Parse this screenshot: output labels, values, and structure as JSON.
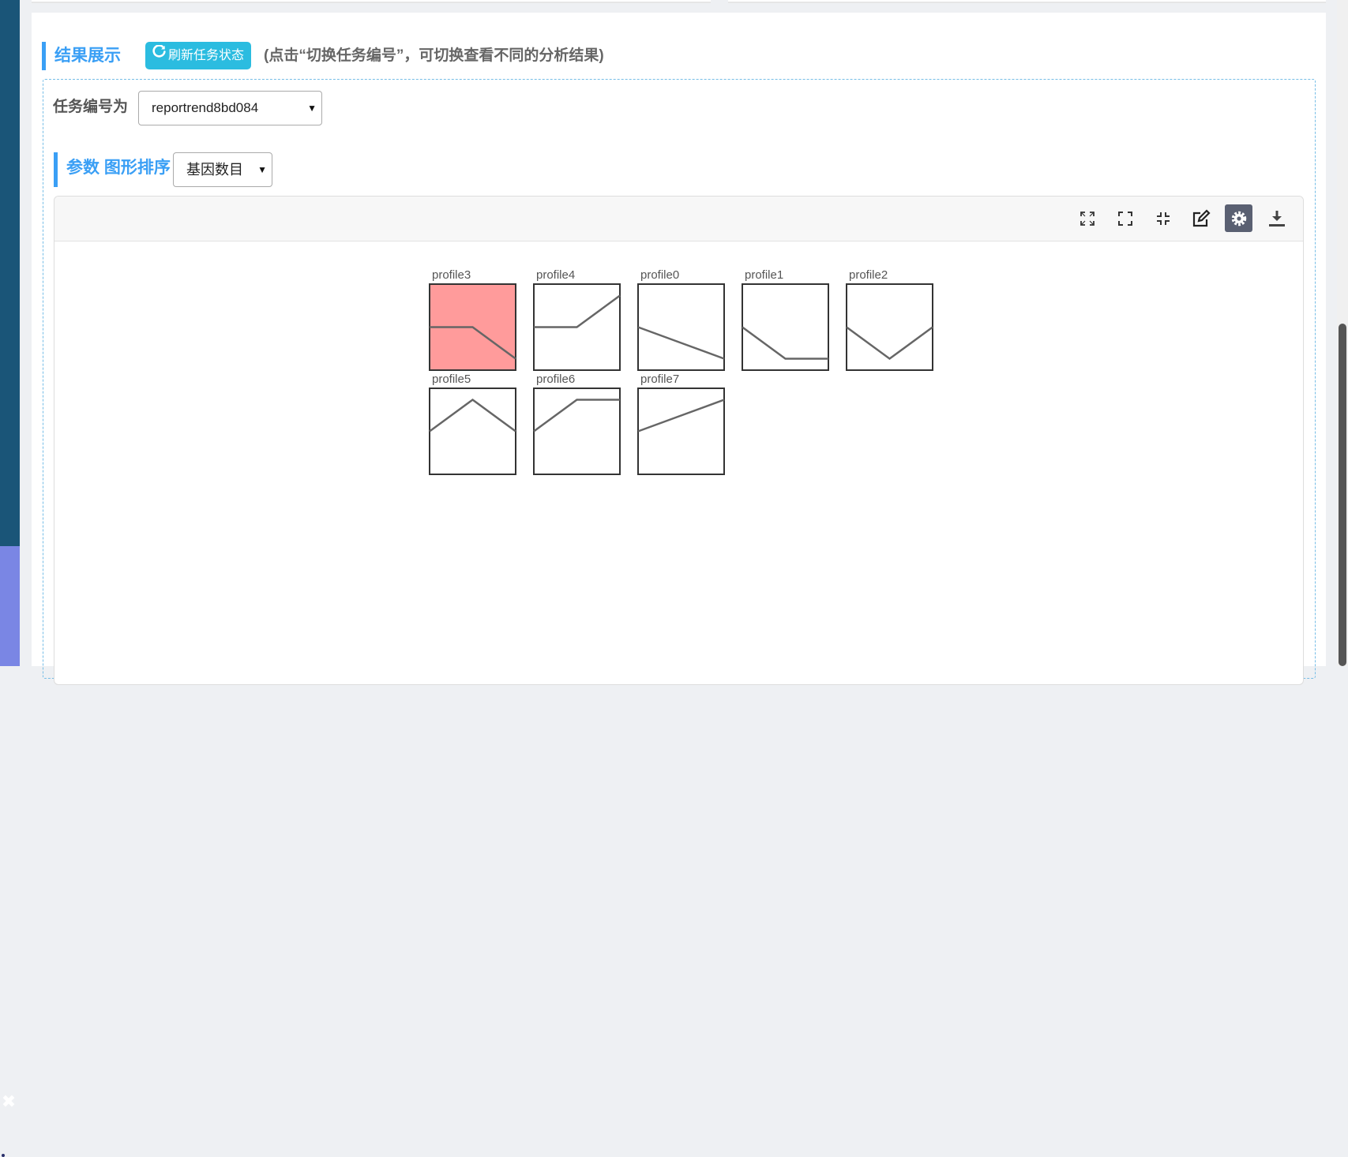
{
  "section": {
    "title": "结果展示",
    "refresh_label": "刷新任务状态",
    "hint": "(点击“切换任务编号”，可切换查看不同的分析结果)"
  },
  "task": {
    "label": "任务编号为",
    "selected": "reportrend8bd084"
  },
  "param": {
    "title": "参数 图形排序",
    "sort_selected": "基因数目"
  },
  "toolbar": {
    "icons": [
      "expand-corners-icon",
      "fullscreen-icon",
      "collapse-icon",
      "edit-icon",
      "settings-icon",
      "download-icon"
    ],
    "active": "settings-icon",
    "active_color": "#5a6072"
  },
  "profiles": [
    {
      "name": "profile3",
      "points": [
        0,
        0,
        -1
      ],
      "highlighted": true
    },
    {
      "name": "profile4",
      "points": [
        0,
        0,
        1
      ],
      "highlighted": false
    },
    {
      "name": "profile0",
      "points": [
        0,
        -0.5,
        -1
      ],
      "highlighted": false
    },
    {
      "name": "profile1",
      "points": [
        0,
        -1,
        -1
      ],
      "highlighted": false
    },
    {
      "name": "profile2",
      "points": [
        0,
        -1,
        0
      ],
      "highlighted": false
    },
    {
      "name": "profile5",
      "points": [
        0,
        1,
        0
      ],
      "highlighted": false
    },
    {
      "name": "profile6",
      "points": [
        0,
        1,
        1
      ],
      "highlighted": false
    },
    {
      "name": "profile7",
      "points": [
        0,
        0.5,
        1
      ],
      "highlighted": false
    }
  ],
  "colors": {
    "accent": "#3a9ff5",
    "refresh_button": "#2bbce0",
    "highlight_fill": "#ff9b9b",
    "line": "#666666"
  }
}
